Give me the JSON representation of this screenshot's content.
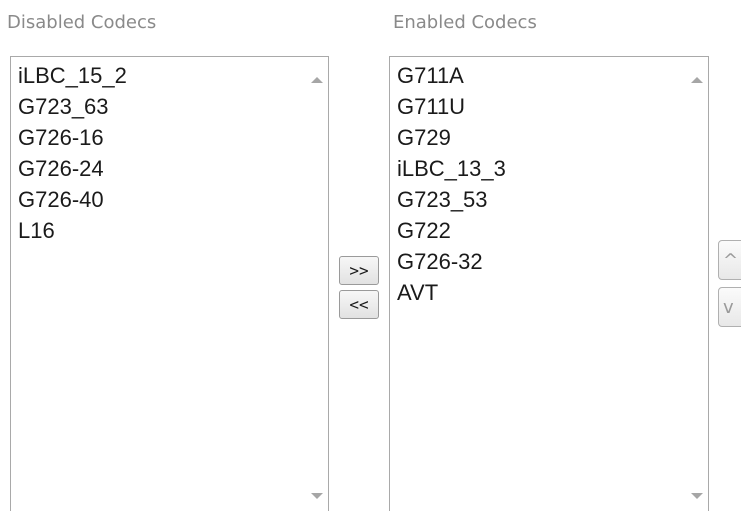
{
  "disabled": {
    "label": "Disabled Codecs",
    "items": [
      "iLBC_15_2",
      "G723_63",
      "G726-16",
      "G726-24",
      "G726-40",
      "L16"
    ]
  },
  "enabled": {
    "label": "Enabled Codecs",
    "items": [
      "G711A",
      "G711U",
      "G729",
      "iLBC_13_3",
      "G723_53",
      "G722",
      "G726-32",
      "AVT"
    ]
  },
  "buttons": {
    "move_right": ">>",
    "move_left": "<<",
    "move_up": "^",
    "move_down": "v"
  },
  "colors": {
    "label": "#8a8a8a",
    "border": "#a9a9a9",
    "text": "#1a1a1a"
  }
}
